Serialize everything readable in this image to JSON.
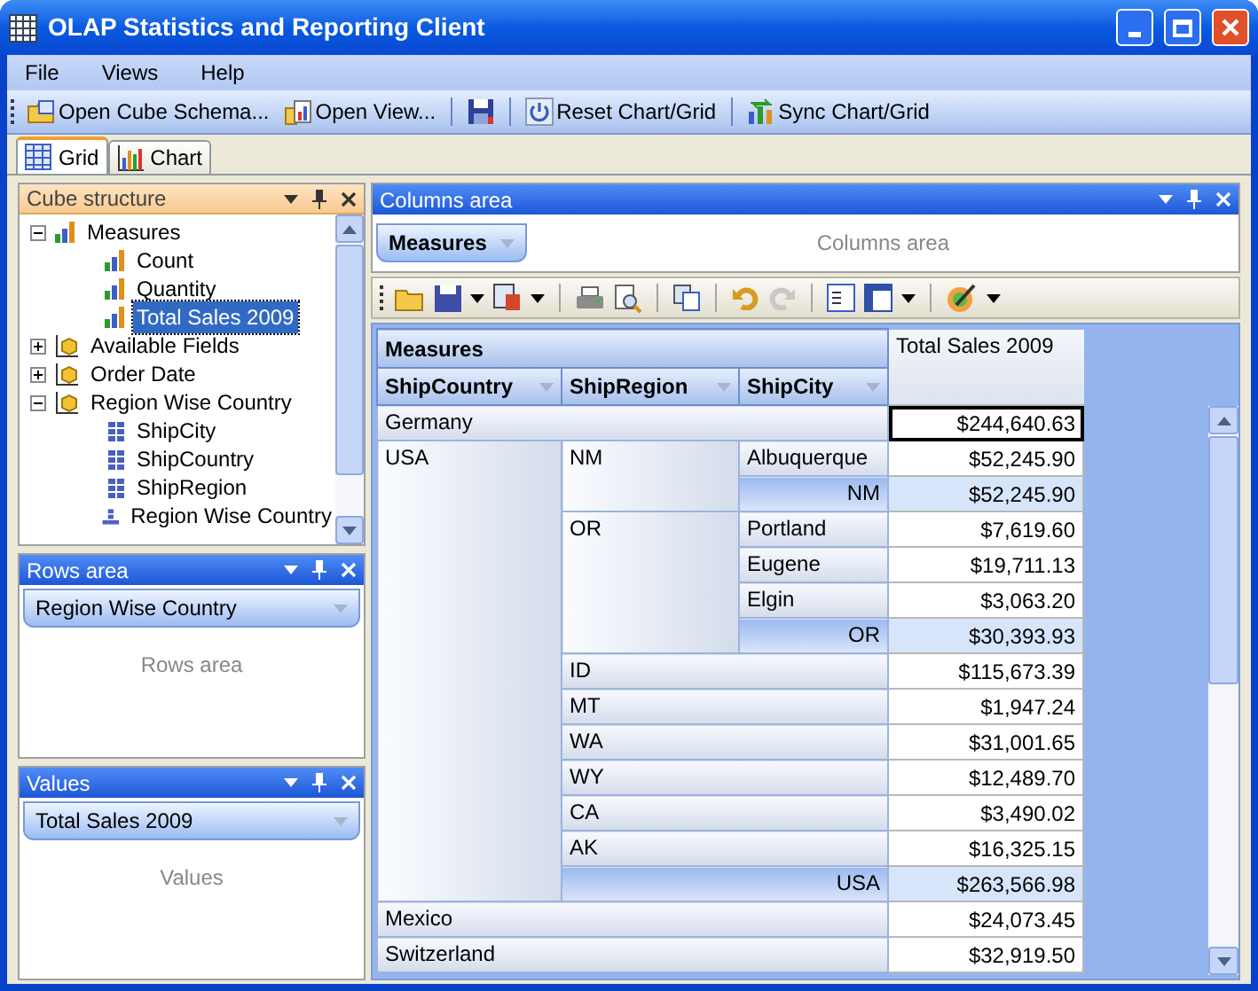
{
  "window": {
    "title": "OLAP Statistics and Reporting Client"
  },
  "menu": [
    "File",
    "Views",
    "Help"
  ],
  "toolbar": [
    {
      "kind": "open-schema",
      "label": "Open Cube Schema..."
    },
    {
      "kind": "open-view",
      "label": "Open View..."
    },
    {
      "kind": "separator"
    },
    {
      "kind": "save"
    },
    {
      "kind": "separator"
    },
    {
      "kind": "reset",
      "label": "Reset Chart/Grid"
    },
    {
      "kind": "separator"
    },
    {
      "kind": "sync",
      "label": "Sync Chart/Grid"
    }
  ],
  "tabs": [
    {
      "label": "Grid",
      "kind": "grid",
      "selected": true
    },
    {
      "label": "Chart",
      "kind": "chart",
      "selected": false
    }
  ],
  "cube_structure": {
    "title": "Cube structure",
    "active": true,
    "tree": [
      {
        "label": "Measures",
        "kind": "measures",
        "selected": false,
        "expanded": true,
        "children": [
          {
            "label": "Count",
            "kind": "measure",
            "selected": false
          },
          {
            "label": "Quantity",
            "kind": "measure",
            "selected": false
          },
          {
            "label": "Total Sales 2009",
            "kind": "measure",
            "selected": true
          }
        ]
      },
      {
        "label": "Available Fields",
        "kind": "dimension",
        "selected": false,
        "expanded": false
      },
      {
        "label": "Order Date",
        "kind": "dimension",
        "selected": false,
        "expanded": false
      },
      {
        "label": "Region Wise Country",
        "kind": "dimension",
        "selected": false,
        "expanded": true,
        "children": [
          {
            "label": "ShipCity",
            "kind": "level",
            "selected": false
          },
          {
            "label": "ShipCountry",
            "kind": "level",
            "selected": false
          },
          {
            "label": "ShipRegion",
            "kind": "level",
            "selected": false
          },
          {
            "label": "Region Wise Country",
            "kind": "hierarchy",
            "selected": false
          }
        ]
      }
    ]
  },
  "rows_area": {
    "title": "Rows area",
    "active": false,
    "fields": [
      "Region Wise Country"
    ],
    "caption": "Rows area"
  },
  "values_area": {
    "title": "Values",
    "active": false,
    "fields": [
      "Total Sales 2009"
    ],
    "caption": "Values"
  },
  "columns_area": {
    "title": "Columns area",
    "active": false,
    "fields": [
      "Measures"
    ],
    "caption": "Columns area"
  },
  "grid": {
    "measures_header": "Measures",
    "value_header": "Total Sales 2009",
    "fields": [
      "ShipCountry",
      "ShipRegion",
      "ShipCity"
    ],
    "rows": [
      {
        "country": "Germany",
        "value": "$244,640.63",
        "selected": true
      },
      {
        "country": "USA",
        "selected": false,
        "regions": [
          {
            "region": "NM",
            "cities": [
              {
                "city": "Albuquerque",
                "value": "$52,245.90"
              }
            ],
            "total_label": "NM",
            "total": "$52,245.90"
          },
          {
            "region": "OR",
            "cities": [
              {
                "city": "Portland",
                "value": "$7,619.60"
              },
              {
                "city": "Eugene",
                "value": "$19,711.13"
              },
              {
                "city": "Elgin",
                "value": "$3,063.20"
              }
            ],
            "total_label": "OR",
            "total": "$30,393.93"
          },
          {
            "region": "ID",
            "value": "$115,673.39"
          },
          {
            "region": "MT",
            "value": "$1,947.24"
          },
          {
            "region": "WA",
            "value": "$31,001.65"
          },
          {
            "region": "WY",
            "value": "$12,489.70"
          },
          {
            "region": "CA",
            "value": "$3,490.02"
          },
          {
            "region": "AK",
            "value": "$16,325.15"
          }
        ],
        "total_label": "USA",
        "total": "$263,566.98"
      },
      {
        "country": "Mexico",
        "value": "$24,073.45",
        "selected": false
      },
      {
        "country": "Switzerland",
        "value": "$32,919.50",
        "selected": false
      }
    ]
  }
}
